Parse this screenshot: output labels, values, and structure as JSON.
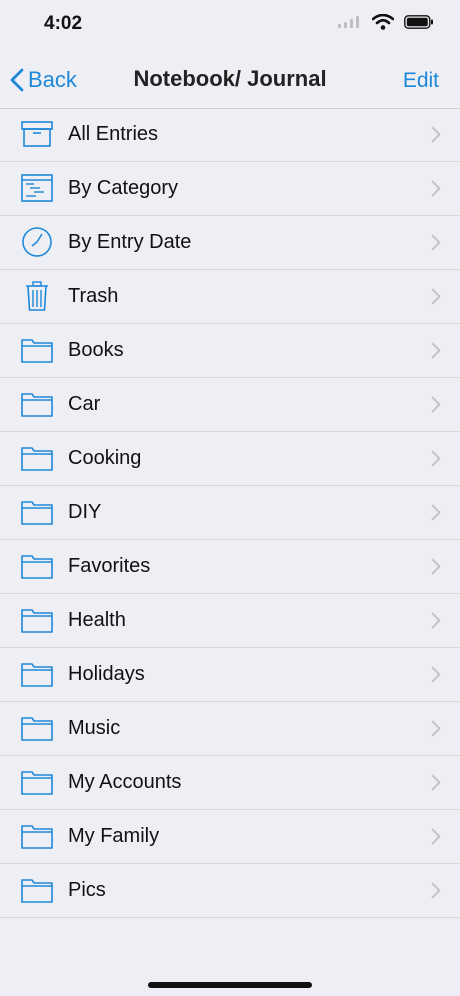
{
  "status": {
    "time": "4:02"
  },
  "nav": {
    "back_label": "Back",
    "title": "Notebook/ Journal",
    "edit_label": "Edit"
  },
  "accent": "#1e88d8",
  "rows": [
    {
      "label": "All Entries",
      "icon": "archive-box-icon"
    },
    {
      "label": "By Category",
      "icon": "category-list-icon"
    },
    {
      "label": "By Entry Date",
      "icon": "clock-icon"
    },
    {
      "label": "Trash",
      "icon": "trash-icon"
    },
    {
      "label": "Books",
      "icon": "folder-icon"
    },
    {
      "label": "Car",
      "icon": "folder-icon"
    },
    {
      "label": "Cooking",
      "icon": "folder-icon"
    },
    {
      "label": "DIY",
      "icon": "folder-icon"
    },
    {
      "label": "Favorites",
      "icon": "folder-icon"
    },
    {
      "label": "Health",
      "icon": "folder-icon"
    },
    {
      "label": "Holidays",
      "icon": "folder-icon"
    },
    {
      "label": "Music",
      "icon": "folder-icon"
    },
    {
      "label": "My Accounts",
      "icon": "folder-icon"
    },
    {
      "label": "My Family",
      "icon": "folder-icon"
    },
    {
      "label": "Pics",
      "icon": "folder-icon"
    }
  ]
}
